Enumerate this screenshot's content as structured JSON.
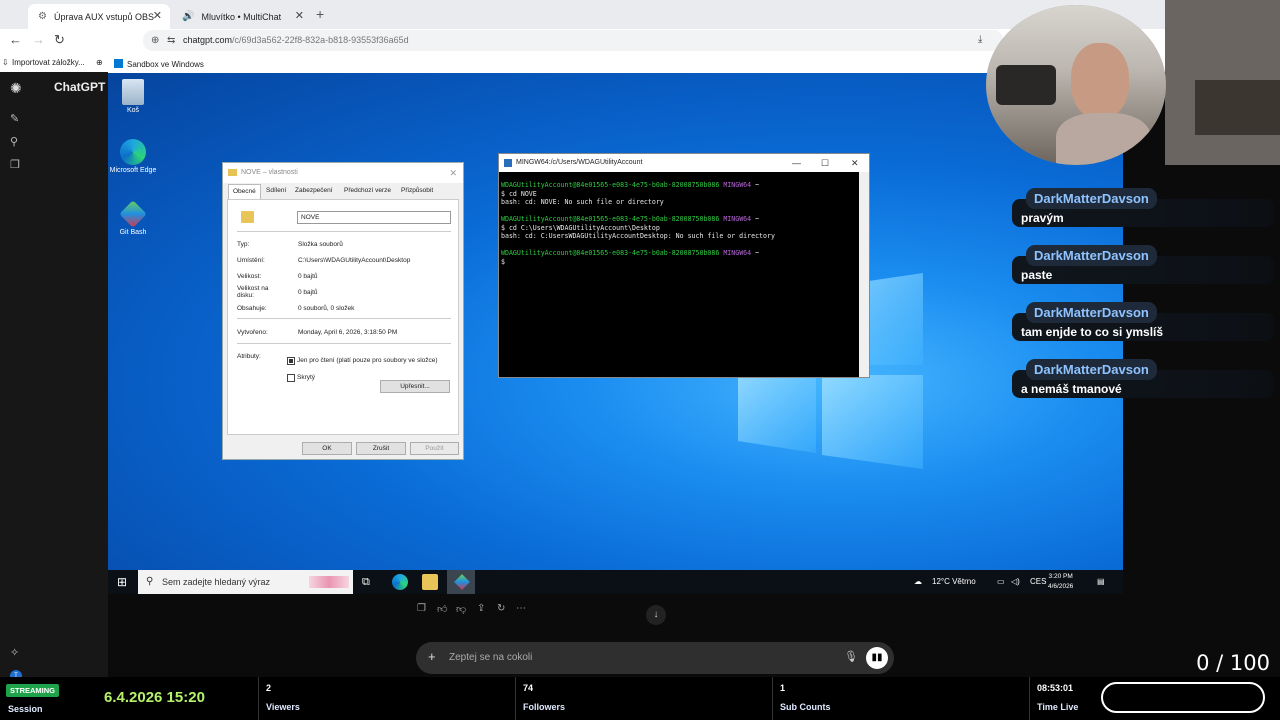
{
  "browser": {
    "tabs": [
      {
        "label": "Úprava AUX vstupů OBS",
        "icon": "gear-icon"
      },
      {
        "label": "Mluvítko • MultiChat",
        "icon": "speaker-icon"
      }
    ],
    "url_host": "chatgpt.com",
    "url_path": "/c/69d3a562-22f8-832a-b818-93553f36a65d",
    "bookmark": "Importovat záložky..."
  },
  "chatgpt": {
    "title": "ChatGPT",
    "prompt_placeholder": "Zeptej se na cokoli",
    "user_initial": "T"
  },
  "sandbox": {
    "title": "Sandbox ve Windows",
    "desktop_icons": [
      "Koš",
      "Microsoft Edge",
      "Git Bash"
    ]
  },
  "properties": {
    "title": "NOVE – vlastnosti",
    "tabs": [
      "Obecné",
      "Sdílení",
      "Zabezpečení",
      "Předchozí verze",
      "Přizpůsobit"
    ],
    "name": "NOVE",
    "rows": [
      {
        "label": "Typ:",
        "value": "Složka souborů"
      },
      {
        "label": "Umístění:",
        "value": "C:\\Users\\WDAGUtilityAccount\\Desktop"
      },
      {
        "label": "Velikost:",
        "value": "0 bajtů"
      },
      {
        "label": "Velikost na disku:",
        "value": "0 bajtů"
      },
      {
        "label": "Obsahuje:",
        "value": "0 souborů, 0 složek"
      },
      {
        "label": "Vytvořeno:",
        "value": "Monday, April 6, 2026, 3:18:50 PM"
      }
    ],
    "attributes_label": "Atributy:",
    "readonly_label": "Jen pro čtení (platí pouze pro soubory ve složce)",
    "hidden_label": "Skrytý",
    "advanced_button": "Upřesnit...",
    "ok_button": "OK",
    "cancel_button": "Zrušit",
    "apply_button": "Použít"
  },
  "terminal": {
    "title": "MINGW64:/c/Users/WDAGUtilityAccount",
    "user_host": "WDAGUtilityAccount@84e01565-e083-4e75-b0ab-82008750b086",
    "env": "MINGW64",
    "prompt_dir": "~",
    "cmd1": "$ cd NOVE",
    "out1": "bash: cd: NOVE: No such file or directory",
    "cmd2": "$ cd C:\\Users\\WDAGUtilityAccount\\Desktop",
    "out2": "bash: cd: C:UsersWDAGUtilityAccountDesktop: No such file or directory",
    "cmd3": "$"
  },
  "taskbar": {
    "search_placeholder": "Sem zadejte hledaný výraz",
    "weather": "12°C Větrno",
    "lang": "CES",
    "time": "3:20 PM",
    "date": "4/6/2026"
  },
  "chat": [
    {
      "user": "DarkMatterDavson",
      "text": "pravým"
    },
    {
      "user": "DarkMatterDavson",
      "text": "paste"
    },
    {
      "user": "DarkMatterDavson",
      "text": "tam enjde to co si ymslíš"
    },
    {
      "user": "DarkMatterDavson",
      "text": "a nemáš tmanové"
    }
  ],
  "counter": "0 / 100",
  "stats": {
    "streaming_badge": "STREAMING",
    "session_date": "6.4.2026 15:20",
    "session_label": "Session",
    "viewers": "2",
    "viewers_label": "Viewers",
    "followers": "74",
    "followers_label": "Followers",
    "subs": "1",
    "subs_label": "Sub Counts",
    "time_live": "08:53:01",
    "time_live_label": "Time Live"
  },
  "colors": {
    "streaming_badge": "#1fa34a",
    "session_date": "#b5f26a",
    "chat_name": "#8fc3ff",
    "desktop_blue": "#0a6bd6"
  }
}
